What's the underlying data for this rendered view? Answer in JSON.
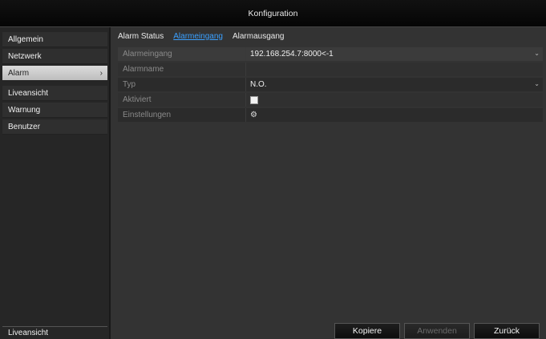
{
  "window": {
    "title": "Konfiguration"
  },
  "sidebar": {
    "items": [
      {
        "label": "Allgemein"
      },
      {
        "label": "Netzwerk"
      },
      {
        "label": "Alarm",
        "active": true
      },
      {
        "label": "Liveansicht"
      },
      {
        "label": "Warnung"
      },
      {
        "label": "Benutzer"
      }
    ],
    "bottom_label": "Liveansicht"
  },
  "tabs": [
    {
      "label": "Alarm Status"
    },
    {
      "label": "Alarmeingang",
      "active": true
    },
    {
      "label": "Alarmausgang"
    }
  ],
  "form": {
    "alarm_input": {
      "label": "Alarmeingang",
      "value": "192.168.254.7:8000<-1"
    },
    "alarm_name": {
      "label": "Alarmname",
      "value": ""
    },
    "type": {
      "label": "Typ",
      "value": "N.O."
    },
    "enabled": {
      "label": "Aktiviert",
      "checked": true
    },
    "settings": {
      "label": "Einstellungen"
    }
  },
  "buttons": {
    "copy": "Kopiere",
    "apply": "Anwenden",
    "back": "Zurück"
  },
  "colors": {
    "accent_tab": "#3aa0ff",
    "background": "#333333"
  }
}
